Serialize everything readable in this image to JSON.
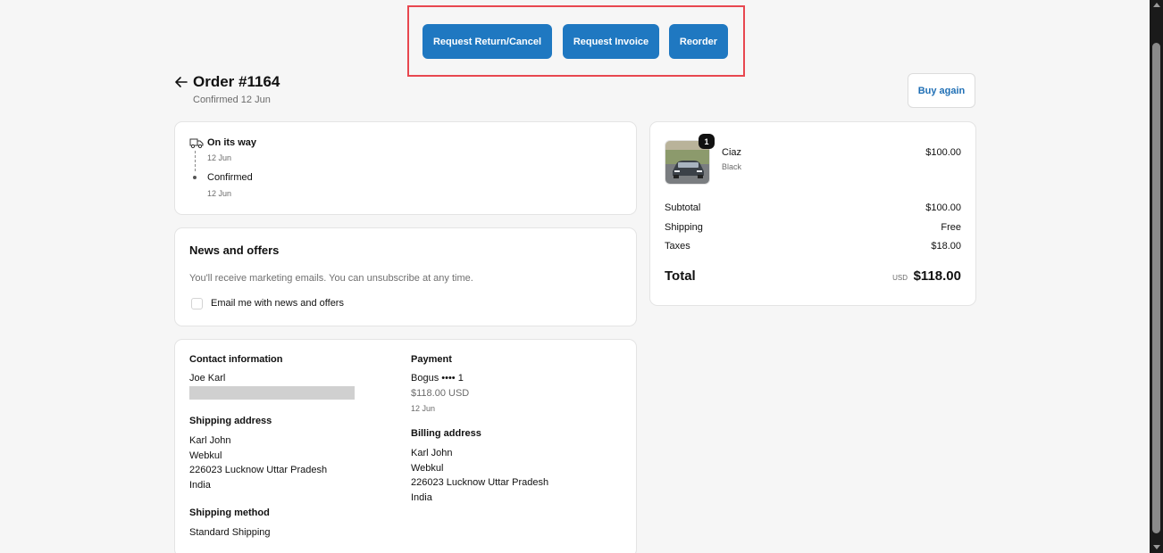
{
  "actions": {
    "return_label": "Request Return/Cancel",
    "invoice_label": "Request Invoice",
    "reorder_label": "Reorder"
  },
  "header": {
    "title": "Order #1164",
    "subtitle": "Confirmed 12 Jun",
    "buy_again_label": "Buy again"
  },
  "status": {
    "current": "On its way",
    "current_date": "12 Jun",
    "previous": "Confirmed",
    "previous_date": "12 Jun"
  },
  "news": {
    "title": "News and offers",
    "description": "You'll receive marketing emails. You can unsubscribe at any time.",
    "checkbox_label": "Email me with news and offers",
    "checked": false
  },
  "contact": {
    "heading": "Contact information",
    "name": "Joe Karl"
  },
  "shipping_address": {
    "heading": "Shipping address",
    "name": "Karl John",
    "company": "Webkul",
    "line": "226023 Lucknow Uttar Pradesh",
    "country": "India"
  },
  "shipping_method": {
    "heading": "Shipping method",
    "value": "Standard Shipping"
  },
  "payment": {
    "heading": "Payment",
    "method": "Bogus •••• 1",
    "amount": "$118.00 USD",
    "date": "12 Jun"
  },
  "billing_address": {
    "heading": "Billing address",
    "name": "Karl John",
    "company": "Webkul",
    "line": "226023 Lucknow Uttar Pradesh",
    "country": "India"
  },
  "summary": {
    "product": {
      "name": "Ciaz",
      "variant": "Black",
      "price": "$100.00",
      "quantity": "1"
    },
    "subtotal_label": "Subtotal",
    "subtotal": "$100.00",
    "shipping_label": "Shipping",
    "shipping": "Free",
    "taxes_label": "Taxes",
    "taxes": "$18.00",
    "total_label": "Total",
    "currency": "USD",
    "total": "$118.00"
  },
  "colors": {
    "primary_button": "#1f78c1",
    "highlight_frame": "#e8474f",
    "link": "#1f6fb5"
  }
}
